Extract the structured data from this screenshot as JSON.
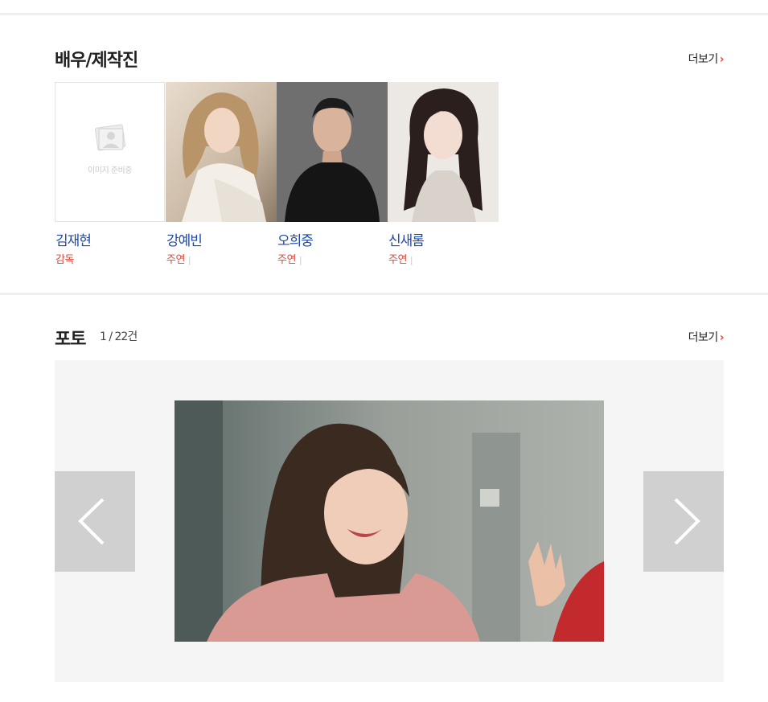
{
  "cast_section": {
    "title": "배우/제작진",
    "more_label": "더보기",
    "placeholder_text": "이미지 준비중",
    "members": [
      {
        "name": "김재현",
        "role": "감독",
        "has_photo": false
      },
      {
        "name": "강예빈",
        "role": "주연",
        "has_photo": true
      },
      {
        "name": "오희중",
        "role": "주연",
        "has_photo": true
      },
      {
        "name": "신새롬",
        "role": "주연",
        "has_photo": true
      }
    ]
  },
  "photo_section": {
    "title": "포토",
    "count": "1 / 22건",
    "more_label": "더보기"
  },
  "icons": {
    "more_chevron": "chevron-right-icon",
    "prev": "chevron-left-icon",
    "next": "chevron-right-icon"
  },
  "colors": {
    "name_link": "#1f4aa8",
    "role_text": "#d9483b",
    "more_chevron": "#e8474a",
    "nav_button": "#d0d0d0",
    "photo_background": "#f5f5f5"
  }
}
